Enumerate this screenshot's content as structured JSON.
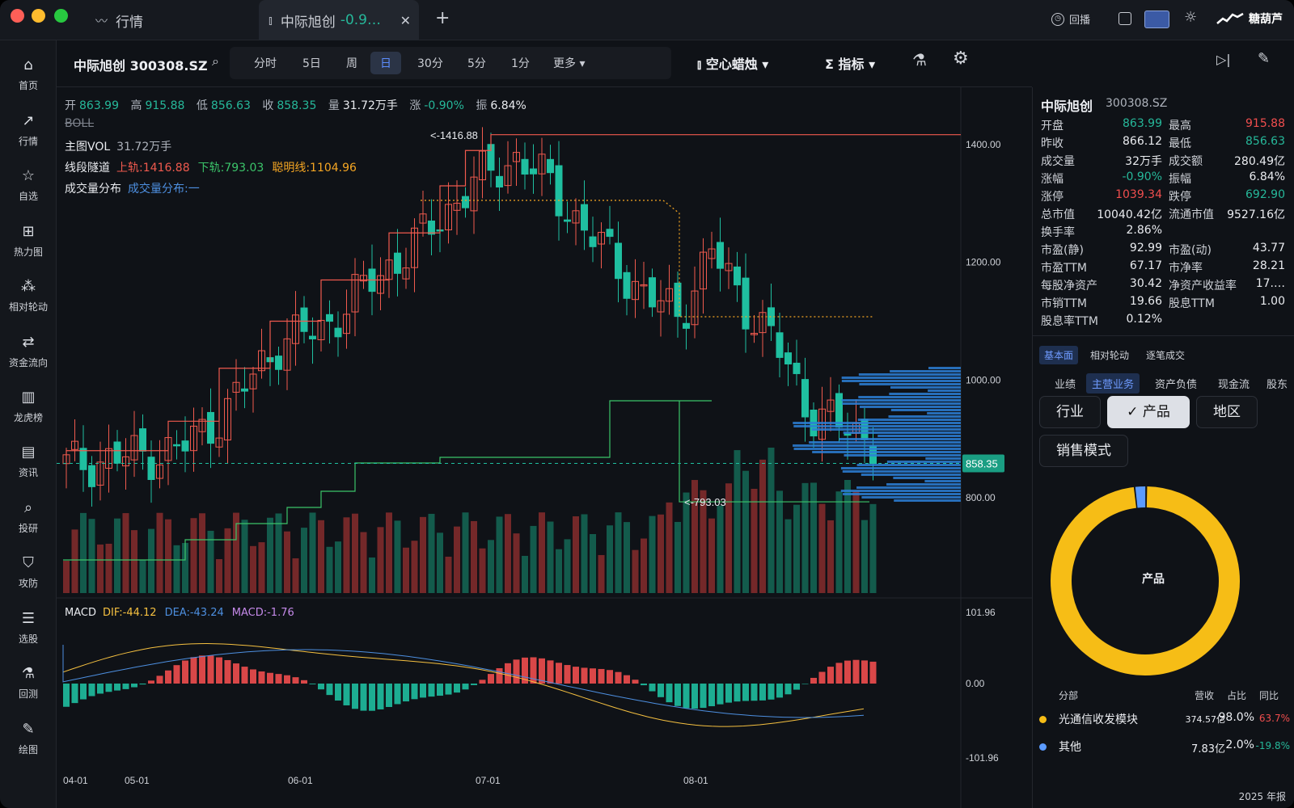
{
  "titlebar": {
    "tab1_label": "行情",
    "tab2_label": "中际旭创",
    "tab2_change": "-0.9…",
    "replay_label": "回播",
    "brand": "糖葫芦"
  },
  "sidebar": {
    "items": [
      {
        "label": "首页",
        "icon": "home-icon"
      },
      {
        "label": "行情",
        "icon": "trend-icon"
      },
      {
        "label": "自选",
        "icon": "star-icon"
      },
      {
        "label": "热力图",
        "icon": "grid-icon"
      },
      {
        "label": "相对轮动",
        "icon": "rotation-icon"
      },
      {
        "label": "资金流向",
        "icon": "flow-icon"
      },
      {
        "label": "龙虎榜",
        "icon": "bar-icon"
      },
      {
        "label": "资讯",
        "icon": "news-icon"
      },
      {
        "label": "投研",
        "icon": "research-icon"
      },
      {
        "label": "攻防",
        "icon": "shield-icon"
      },
      {
        "label": "选股",
        "icon": "filter-icon"
      },
      {
        "label": "回测",
        "icon": "flask-icon"
      },
      {
        "label": "绘图",
        "icon": "pen-icon"
      }
    ]
  },
  "toolbar": {
    "stock_title": "中际旭创 300308.SZ",
    "periods": [
      "分时",
      "5日",
      "周",
      "日",
      "30分",
      "5分",
      "1分",
      "更多 ▾"
    ],
    "active_period": "日",
    "candle_type": "空心蜡烛 ▾",
    "indicator": "指标 ▾"
  },
  "ohlc": {
    "open_label": "开",
    "open": "863.99",
    "high_label": "高",
    "high": "915.88",
    "low_label": "低",
    "low": "856.63",
    "close_label": "收",
    "close": "858.35",
    "vol_label": "量",
    "vol": "31.72万手",
    "chg_label": "涨",
    "chg": "-0.90%",
    "amp_label": "振",
    "amp": "6.84%"
  },
  "legends": {
    "boll": "BOLL",
    "vol_title": "主图VOL",
    "vol_value": "31.72万手",
    "channel_title": "线段隧道",
    "channel_upper": "上轨:1416.88",
    "channel_lower": "下轨:793.03",
    "channel_mid": "聪明线:1104.96",
    "dist_title": "成交量分布",
    "dist_value": "成交量分布:一",
    "macd_title": "MACD",
    "macd_dif": "DIF:-44.12",
    "macd_dea": "DEA:-43.24",
    "macd_val": "MACD:-1.76"
  },
  "chart_data": {
    "type": "candlestick",
    "y_ticks": [
      "1400.00",
      "1200.00",
      "1000.00",
      "800.00"
    ],
    "price_tag": "858.35",
    "peak_label": "<-1416.88",
    "trough_label": "<-793.03",
    "macd_ticks": [
      "101.96",
      "0.00",
      "-101.96"
    ],
    "x_ticks": [
      "04-01",
      "05-01",
      "06-01",
      "07-01",
      "08-01"
    ],
    "ylim": [
      790,
      1440
    ],
    "upper_channel": 1416.88,
    "lower_channel": 793.03,
    "smart_line": 1104.96,
    "close_line": 858.35
  },
  "quote": {
    "name": "中际旭创",
    "code": "300308.SZ",
    "rows": [
      {
        "l1": "开盘",
        "v1": "863.99",
        "c1": "green",
        "l2": "最高",
        "v2": "915.88",
        "c2": "red"
      },
      {
        "l1": "昨收",
        "v1": "866.12",
        "c1": "",
        "l2": "最低",
        "v2": "856.63",
        "c2": "green"
      },
      {
        "l1": "成交量",
        "v1": "32万手",
        "c1": "",
        "l2": "成交额",
        "v2": "280.49亿",
        "c2": ""
      },
      {
        "l1": "涨幅",
        "v1": "-0.90%",
        "c1": "green",
        "l2": "振幅",
        "v2": "6.84%",
        "c2": ""
      },
      {
        "l1": "涨停",
        "v1": "1039.34",
        "c1": "red",
        "l2": "跌停",
        "v2": "692.90",
        "c2": "green"
      },
      {
        "l1": "总市值",
        "v1": "10040.42亿",
        "c1": "",
        "l2": "流通市值",
        "v2": "9527.16亿",
        "c2": ""
      },
      {
        "l1": "换手率",
        "v1": "2.86%",
        "c1": "",
        "l2": "",
        "v2": "",
        "c2": ""
      },
      {
        "l1": "市盈(静)",
        "v1": "92.99",
        "c1": "",
        "l2": "市盈(动)",
        "v2": "43.77",
        "c2": ""
      },
      {
        "l1": "市盈TTM",
        "v1": "67.17",
        "c1": "",
        "l2": "市净率",
        "v2": "28.21",
        "c2": ""
      },
      {
        "l1": "每股净资产",
        "v1": "30.42",
        "c1": "",
        "l2": "净资产收益率",
        "v2": "17.…",
        "c2": ""
      },
      {
        "l1": "市销TTM",
        "v1": "19.66",
        "c1": "",
        "l2": "股息TTM",
        "v2": "1.00",
        "c2": ""
      },
      {
        "l1": "股息率TTM",
        "v1": "0.12%",
        "c1": "",
        "l2": "",
        "v2": "",
        "c2": ""
      }
    ]
  },
  "fundamentals": {
    "tabs": [
      "基本面",
      "相对轮动",
      "逐笔成交"
    ],
    "sub_tabs": [
      "业绩",
      "主营业务",
      "资产负债",
      "现金流",
      "股东"
    ],
    "seg": [
      "行业",
      "产品",
      "地区",
      "销售模式"
    ],
    "seg_check": "✓",
    "donut_center": "产品",
    "table_headers": [
      "分部",
      "营收",
      "占比",
      "同比"
    ],
    "rows": [
      {
        "name": "光通信收发模块",
        "revenue": "374.57亿",
        "share": 98.0,
        "share_label": "98.0%",
        "yoy": "63.7%",
        "color": "#f6bd16"
      },
      {
        "name": "其他",
        "revenue": "7.83亿",
        "share": 2.0,
        "share_label": "2.0%",
        "yoy": "-19.8%",
        "color": "#5b9bff"
      }
    ],
    "footer": "2025 年报"
  }
}
